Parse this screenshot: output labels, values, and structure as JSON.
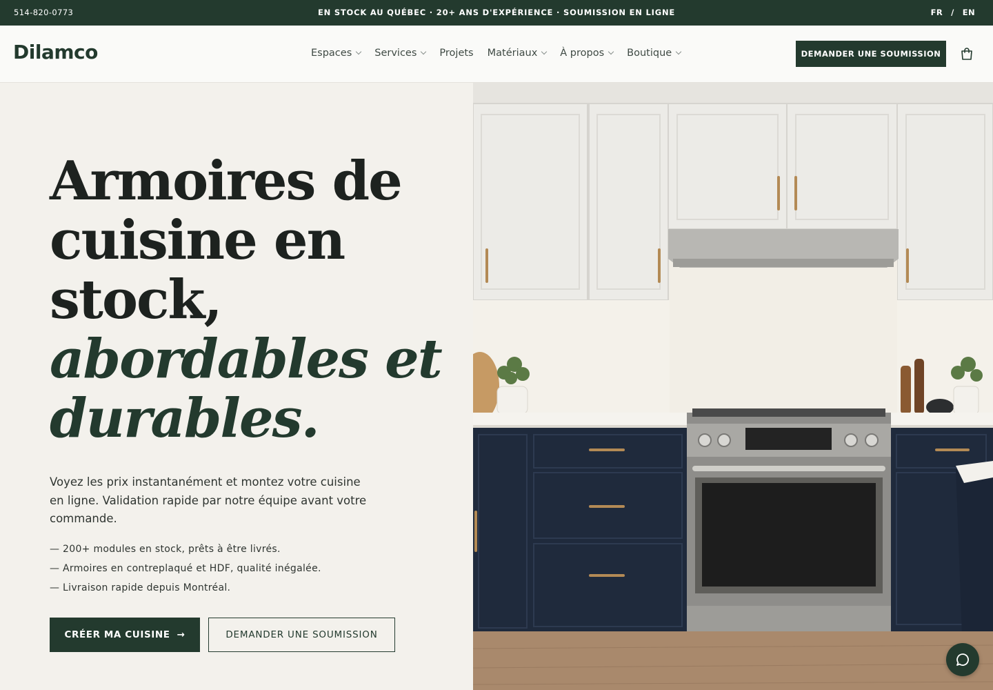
{
  "topbar": {
    "phone": "514-820-0773",
    "tagline": "EN STOCK AU QUÉBEC · 20+ ANS D'EXPÉRIENCE · SOUMISSION EN LIGNE",
    "lang_fr": "FR",
    "lang_sep": "/",
    "lang_en": "EN"
  },
  "header": {
    "logo": "Dilamco",
    "nav": [
      {
        "label": "Espaces",
        "dropdown": true
      },
      {
        "label": "Services",
        "dropdown": true
      },
      {
        "label": "Projets",
        "dropdown": false
      },
      {
        "label": "Matériaux",
        "dropdown": true
      },
      {
        "label": "À propos",
        "dropdown": true
      },
      {
        "label": "Boutique",
        "dropdown": true
      }
    ],
    "cta": "DEMANDER UNE SOUMISSION",
    "cart_icon": "shopping-bag-icon"
  },
  "hero": {
    "headline_lines": [
      "Armoires de",
      "cuisine en",
      "stock,"
    ],
    "headline_italic_lines": [
      "abordables et",
      "durables."
    ],
    "subtitle": "Voyez les prix instantanément et montez votre cuisine en ligne. Validation rapide par notre équipe avant votre commande.",
    "bullets": [
      "— 200+ modules en stock, prêts à être livrés.",
      "— Armoires en contreplaqué et HDF, qualité inégalée.",
      "— Livraison rapide depuis Montréal."
    ],
    "primary_button": "CRÉER MA CUISINE",
    "primary_arrow": "→",
    "secondary_button": "DEMANDER UNE SOUMISSION"
  },
  "chat": {
    "icon": "chat-bubble-icon"
  },
  "colors": {
    "brand_green": "#233a2e",
    "background": "#f3f1ec",
    "navy_cabinets": "#1f2a3c",
    "white_cabinets": "#eeeeea",
    "brass": "#b38a55"
  }
}
